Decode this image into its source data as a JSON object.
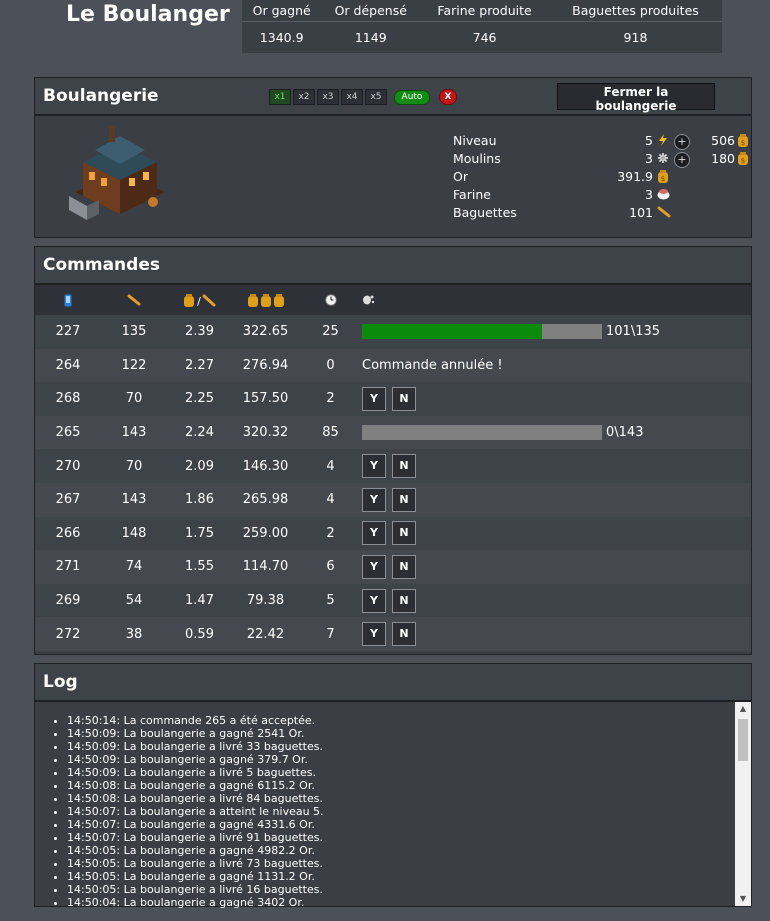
{
  "app": {
    "title": "Le Boulanger"
  },
  "stats": {
    "headers": [
      "Or gagné",
      "Or dépensé",
      "Farine produite",
      "Baguettes produites"
    ],
    "values": [
      "1340.9",
      "1149",
      "746",
      "918"
    ]
  },
  "bakery": {
    "title": "Boulangerie",
    "speeds": [
      "x1",
      "x2",
      "x3",
      "x4",
      "x5"
    ],
    "active_speed": "x1",
    "auto_label": "Auto",
    "stop_label": "X",
    "close_label": "Fermer la boulangerie",
    "attributes": [
      {
        "label": "Niveau",
        "value": "5",
        "icon": "lightning-icon",
        "upgrade_cost": "506"
      },
      {
        "label": "Moulins",
        "value": "3",
        "icon": "mill-icon",
        "upgrade_cost": "180"
      },
      {
        "label": "Or",
        "value": "391.9",
        "icon": "gold-coin-icon"
      },
      {
        "label": "Farine",
        "value": "3",
        "icon": "flour-sack-icon"
      },
      {
        "label": "Baguettes",
        "value": "101",
        "icon": "baguette-icon"
      }
    ],
    "upgrade_symbol": "+",
    "colors": {
      "gold": "#e0a019",
      "auto_green": "#138c13",
      "stop_red": "#c21616"
    }
  },
  "orders": {
    "title": "Commandes",
    "columns": [
      "phone-icon",
      "baguette-icon",
      "gold-per-baguette-icon",
      "three-coins-icon",
      "clock-icon",
      "action-icon"
    ],
    "yes_label": "Y",
    "no_label": "N",
    "rows": [
      {
        "id": "227",
        "qty": "135",
        "ratio": "2.39",
        "total": "322.65",
        "time": "25",
        "state": "progress",
        "progress": 0.748,
        "progress_text": "101\\135"
      },
      {
        "id": "264",
        "qty": "122",
        "ratio": "2.27",
        "total": "276.94",
        "time": "0",
        "state": "cancelled",
        "message": "Commande annulée !"
      },
      {
        "id": "268",
        "qty": "70",
        "ratio": "2.25",
        "total": "157.50",
        "time": "2",
        "state": "pending"
      },
      {
        "id": "265",
        "qty": "143",
        "ratio": "2.24",
        "total": "320.32",
        "time": "85",
        "state": "progress",
        "progress": 0,
        "progress_text": "0\\143"
      },
      {
        "id": "270",
        "qty": "70",
        "ratio": "2.09",
        "total": "146.30",
        "time": "4",
        "state": "pending"
      },
      {
        "id": "267",
        "qty": "143",
        "ratio": "1.86",
        "total": "265.98",
        "time": "4",
        "state": "pending"
      },
      {
        "id": "266",
        "qty": "148",
        "ratio": "1.75",
        "total": "259.00",
        "time": "2",
        "state": "pending"
      },
      {
        "id": "271",
        "qty": "74",
        "ratio": "1.55",
        "total": "114.70",
        "time": "6",
        "state": "pending"
      },
      {
        "id": "269",
        "qty": "54",
        "ratio": "1.47",
        "total": "79.38",
        "time": "5",
        "state": "pending"
      },
      {
        "id": "272",
        "qty": "38",
        "ratio": "0.59",
        "total": "22.42",
        "time": "7",
        "state": "pending"
      }
    ]
  },
  "log": {
    "title": "Log",
    "entries": [
      "14:50:14: La commande 265 a été acceptée.",
      "14:50:09: La boulangerie a gagné 2541 Or.",
      "14:50:09: La boulangerie a livré 33 baguettes.",
      "14:50:09: La boulangerie a gagné 379.7 Or.",
      "14:50:09: La boulangerie a livré 5 baguettes.",
      "14:50:08: La boulangerie a gagné 6115.2 Or.",
      "14:50:08: La boulangerie a livré 84 baguettes.",
      "14:50:07: La boulangerie a atteint le niveau 5.",
      "14:50:07: La boulangerie a gagné 4331.6 Or.",
      "14:50:07: La boulangerie a livré 91 baguettes.",
      "14:50:05: La boulangerie a gagné 4982.2 Or.",
      "14:50:05: La boulangerie a livré 73 baguettes.",
      "14:50:05: La boulangerie a gagné 1131.2 Or.",
      "14:50:05: La boulangerie a livré 16 baguettes.",
      "14:50:04: La boulangerie a gagné 3402 Or."
    ]
  }
}
